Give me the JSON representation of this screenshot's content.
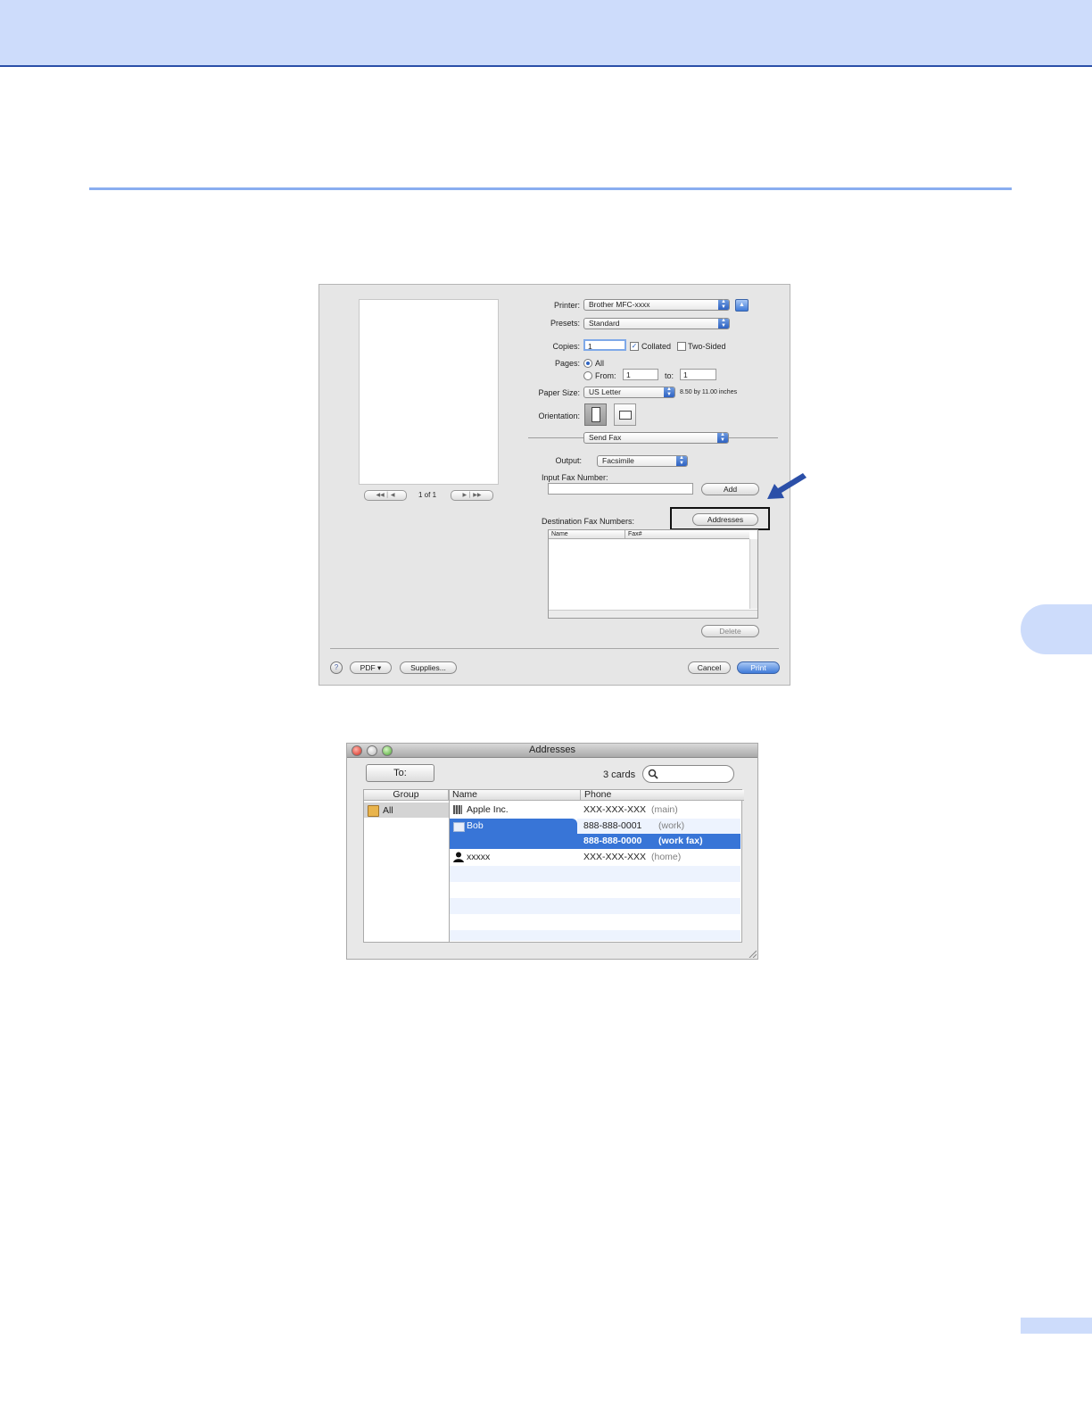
{
  "print_dialog": {
    "preview": {
      "page_indicator": "1 of 1"
    },
    "printer": {
      "label": "Printer:",
      "value": "Brother MFC-xxxx"
    },
    "presets": {
      "label": "Presets:",
      "value": "Standard"
    },
    "copies": {
      "label": "Copies:",
      "value": "1",
      "collated_label": "Collated",
      "collated_checked": true,
      "two_sided_label": "Two-Sided",
      "two_sided_checked": false
    },
    "pages": {
      "label": "Pages:",
      "all_label": "All",
      "from_label": "From:",
      "from_value": "1",
      "to_label": "to:",
      "to_value": "1",
      "selected": "All"
    },
    "paper_size": {
      "label": "Paper Size:",
      "value": "US Letter",
      "dimensions": "8.50 by 11.00 inches"
    },
    "orientation": {
      "label": "Orientation:",
      "selected": "portrait"
    },
    "panel": {
      "value": "Send Fax"
    },
    "output": {
      "label": "Output:",
      "value": "Facsimile"
    },
    "input_fax": {
      "label": "Input Fax Number:",
      "value": "",
      "add_button": "Add"
    },
    "destination": {
      "label": "Destination Fax Numbers:",
      "addresses_button": "Addresses",
      "columns": [
        "Name",
        "Fax#"
      ],
      "delete_button": "Delete"
    },
    "footer": {
      "help": "?",
      "pdf_button": "PDF ▾",
      "supplies_button": "Supplies...",
      "cancel_button": "Cancel",
      "print_button": "Print"
    }
  },
  "addresses_window": {
    "title": "Addresses",
    "to_button": "To:",
    "card_count": "3 cards",
    "search_placeholder": "",
    "columns": {
      "group": "Group",
      "name": "Name",
      "phone": "Phone"
    },
    "groups": [
      "All"
    ],
    "rows": [
      {
        "name": "Apple Inc.",
        "phone": "XXX-XXX-XXX",
        "type": "(main)",
        "icon": "building-icon"
      },
      {
        "name": "Bob",
        "phone": "888-888-0001",
        "type": "(work)",
        "icon": "card-icon"
      },
      {
        "name": "",
        "phone": "888-888-0000",
        "type": "(work fax)",
        "icon": ""
      },
      {
        "name": "xxxxx",
        "phone": "XXX-XXX-XXX",
        "type": "(home)",
        "icon": "person-icon"
      }
    ]
  },
  "colors": {
    "accent": "#2b4fa8",
    "band": "#cddcfb",
    "selection": "#3875d7"
  }
}
